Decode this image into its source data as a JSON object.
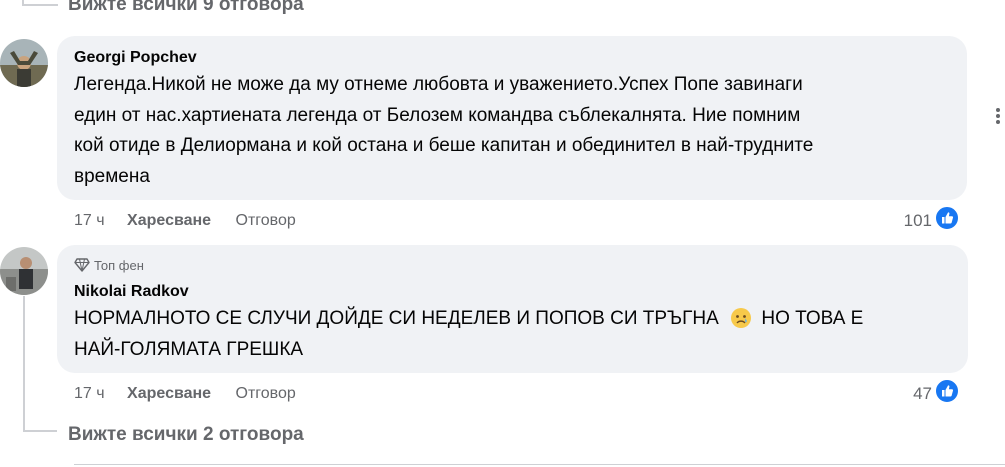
{
  "top_see_all": "Вижте всички 9 отговора",
  "comments": [
    {
      "author": "Georgi Popchev",
      "text_lines": [
        "Легенда.Никой не може да му отнеме любовта и уважението.Успех Попе завинаги",
        "един от нас.хартиената легенда от Белозем командва съблекалнята. Ние помним",
        "кой отиде в Делиормана и кой остана и беше капитан и обединител в най-трудните",
        "времена"
      ],
      "time": "17 ч",
      "like_label": "Харесване",
      "reply_label": "Отговор",
      "reaction_count": "101"
    },
    {
      "badge": "Топ фен",
      "author": "Nikolai Radkov",
      "text_line1": "НОРМАЛНОТО СЕ СЛУЧИ ДОЙДЕ СИ НЕДЕЛЕВ И ПОПОВ СИ ТРЪГНА",
      "text_line1_end": "НО ТОВА Е",
      "text_line2": "НАЙ-ГОЛЯМАТА ГРЕШКА",
      "time": "17 ч",
      "like_label": "Харесване",
      "reply_label": "Отговор",
      "reaction_count": "47"
    }
  ],
  "bottom_see_all": "Вижте всички 2 отговора",
  "colors": {
    "bubble": "#f0f2f5",
    "meta_text": "#65676b",
    "like_blue": "#1877f2",
    "thread_line": "#ced0d4"
  },
  "icons": [
    "three-dots-icon",
    "like-icon",
    "diamond-icon",
    "sad-emoji-icon"
  ]
}
